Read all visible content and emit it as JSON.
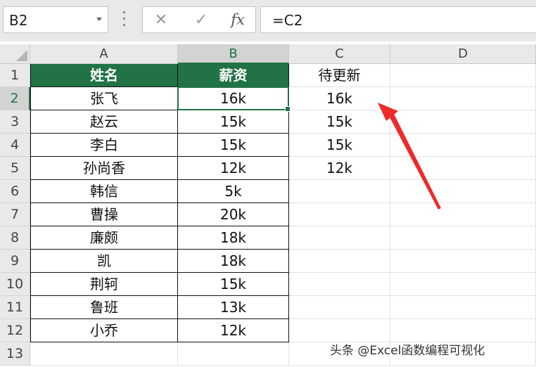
{
  "formula_bar": {
    "name_box": "B2",
    "cancel_icon": "✕",
    "enter_icon": "✓",
    "fx_label": "fx",
    "formula": "=C2"
  },
  "columns": [
    "A",
    "B",
    "C",
    "D"
  ],
  "rows": [
    "1",
    "2",
    "3",
    "4",
    "5",
    "6",
    "7",
    "8",
    "9",
    "10",
    "11",
    "12",
    "13"
  ],
  "selected_cell": "B2",
  "table": {
    "headers": [
      "姓名",
      "薪资"
    ],
    "rows": [
      [
        "张飞",
        "16k"
      ],
      [
        "赵云",
        "15k"
      ],
      [
        "李白",
        "15k"
      ],
      [
        "孙尚香",
        "12k"
      ],
      [
        "韩信",
        "5k"
      ],
      [
        "曹操",
        "20k"
      ],
      [
        "廉颇",
        "18k"
      ],
      [
        "凯",
        "18k"
      ],
      [
        "荆轲",
        "15k"
      ],
      [
        "鲁班",
        "13k"
      ],
      [
        "小乔",
        "12k"
      ]
    ]
  },
  "column_c": [
    "待更新",
    "16k",
    "15k",
    "15k",
    "12k"
  ],
  "colors": {
    "header_fill": "#217346",
    "selection": "#217346",
    "arrow": "#ee2a2a"
  },
  "watermark": "头条 @Excel函数编程可视化"
}
